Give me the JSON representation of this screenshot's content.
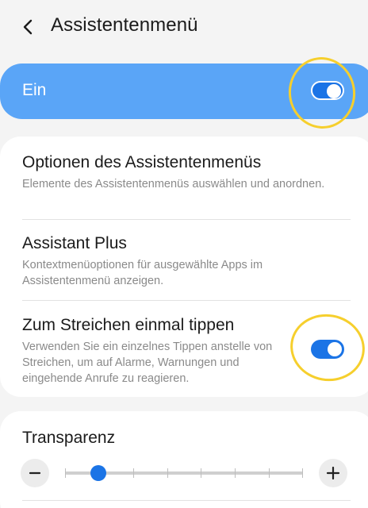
{
  "header": {
    "title": "Assistentenmenü",
    "back_icon": "chevron-left-icon"
  },
  "master": {
    "label": "Ein",
    "enabled": true
  },
  "settings": [
    {
      "title": "Optionen des Assistentenmenüs",
      "subtitle": "Elemente des Assistentenmenüs auswählen und anordnen."
    },
    {
      "title": "Assistant Plus",
      "subtitle": "Kontextmenüoptionen für ausgewählte Apps im Assistentenmenü anzeigen."
    },
    {
      "title": "Zum Streichen einmal tippen",
      "subtitle": "Verwenden Sie ein einzelnes Tippen anstelle von Streichen, um auf Alarme, Warnungen und eingehende Anrufe zu reagieren.",
      "enabled": true
    }
  ],
  "transparency": {
    "title": "Transparenz",
    "level": 0.14,
    "steps": 8,
    "minus_icon": "minus-icon",
    "plus_icon": "plus-icon"
  },
  "colors": {
    "accent": "#1b74e6",
    "master_bar": "#5aa5f7",
    "annotation": "#f6cf2d"
  }
}
